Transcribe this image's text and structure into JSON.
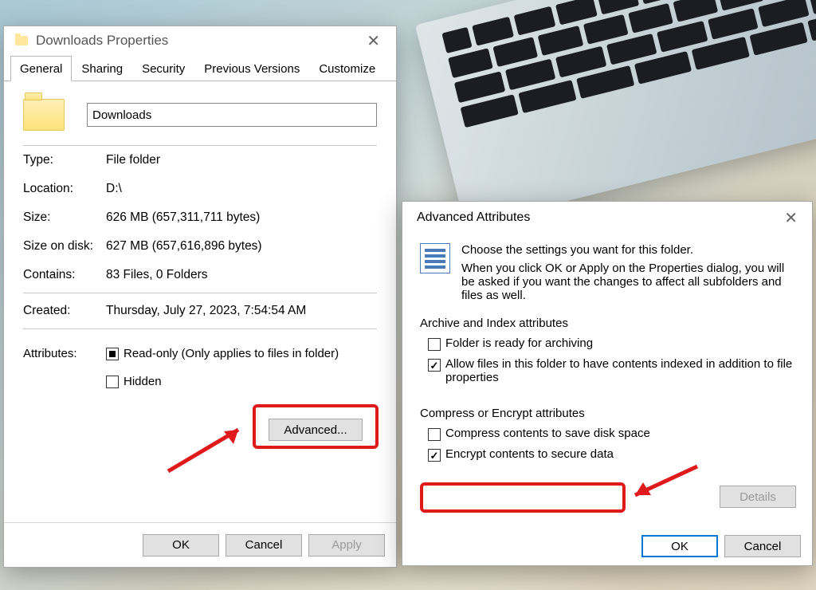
{
  "properties": {
    "window_title": "Downloads Properties",
    "tabs": [
      "General",
      "Sharing",
      "Security",
      "Previous Versions",
      "Customize"
    ],
    "active_tab": 0,
    "folder_name": "Downloads",
    "rows": {
      "type_label": "Type:",
      "type_value": "File folder",
      "location_label": "Location:",
      "location_value": "D:\\",
      "size_label": "Size:",
      "size_value": "626 MB (657,311,711 bytes)",
      "sizeondisk_label": "Size on disk:",
      "sizeondisk_value": "627 MB (657,616,896 bytes)",
      "contains_label": "Contains:",
      "contains_value": "83 Files, 0 Folders",
      "created_label": "Created:",
      "created_value": "Thursday, July 27, 2023, 7:54:54 AM"
    },
    "attributes_label": "Attributes:",
    "readonly_label": "Read-only (Only applies to files in folder)",
    "hidden_label": "Hidden",
    "advanced_button": "Advanced...",
    "ok": "OK",
    "cancel": "Cancel",
    "apply": "Apply"
  },
  "advanced": {
    "title": "Advanced Attributes",
    "intro1": "Choose the settings you want for this folder.",
    "intro2": "When you click OK or Apply on the Properties dialog, you will be asked if you want the changes to affect all subfolders and files as well.",
    "section1": "Archive and Index attributes",
    "archive_label": "Folder is ready for archiving",
    "index_label": "Allow files in this folder to have contents indexed in addition to file properties",
    "section2": "Compress or Encrypt attributes",
    "compress_label": "Compress contents to save disk space",
    "encrypt_label": "Encrypt contents to secure data",
    "details": "Details",
    "ok": "OK",
    "cancel": "Cancel"
  },
  "annotations": {
    "highlight_color": "#e01a1a"
  }
}
